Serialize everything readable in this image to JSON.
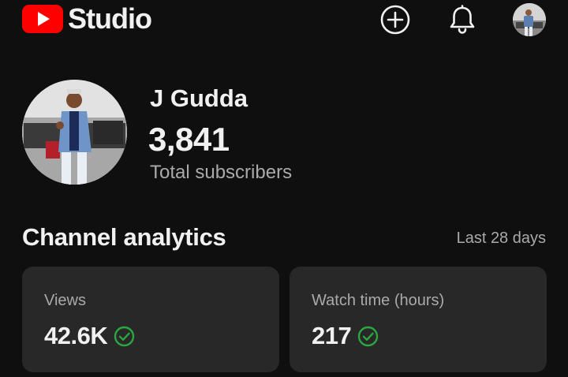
{
  "header": {
    "app_name": "Studio",
    "logo_icon": "youtube-logo-icon",
    "create_icon": "add-circle-icon",
    "notifications_icon": "bell-icon",
    "brand_color": "#ff0000"
  },
  "channel": {
    "name": "J Gudda",
    "subscriber_count": "3,841",
    "subscriber_label": "Total subscribers"
  },
  "analytics": {
    "title": "Channel analytics",
    "range": "Last 28 days",
    "cards": [
      {
        "label": "Views",
        "value": "42.6K",
        "status_icon": "check-circle-icon",
        "status_color": "#2ba640"
      },
      {
        "label": "Watch time (hours)",
        "value": "217",
        "status_icon": "check-circle-icon",
        "status_color": "#2ba640"
      }
    ]
  }
}
